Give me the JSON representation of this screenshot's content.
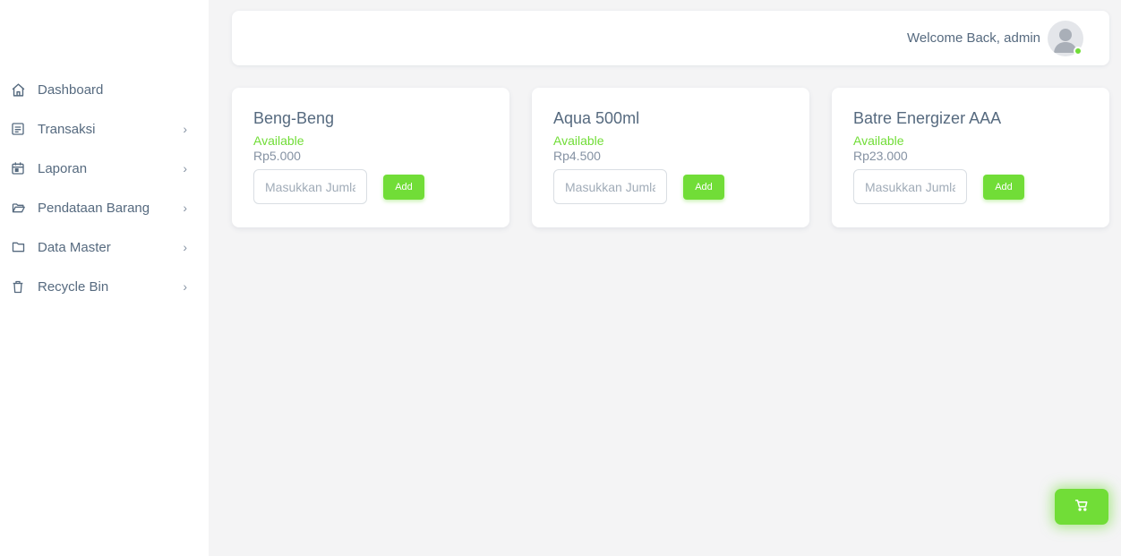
{
  "sidebar": {
    "items": [
      {
        "label": "Dashboard",
        "icon": "home-icon",
        "has_submenu": false
      },
      {
        "label": "Transaksi",
        "icon": "receipt-icon",
        "has_submenu": true
      },
      {
        "label": "Laporan",
        "icon": "calendar-icon",
        "has_submenu": true
      },
      {
        "label": "Pendataan Barang",
        "icon": "folder-open-icon",
        "has_submenu": true
      },
      {
        "label": "Data Master",
        "icon": "folder-icon",
        "has_submenu": true
      },
      {
        "label": "Recycle Bin",
        "icon": "trash-icon",
        "has_submenu": true
      }
    ],
    "chevron": "›"
  },
  "navbar": {
    "welcome": "Welcome Back, admin",
    "avatar_icon": "user-avatar-icon",
    "status": "online"
  },
  "products": [
    {
      "name": "Beng-Beng",
      "status": "Available",
      "price": "Rp5.000",
      "qty_placeholder": "Masukkan Jumlah",
      "add_label": "Add"
    },
    {
      "name": "Aqua 500ml",
      "status": "Available",
      "price": "Rp4.500",
      "qty_placeholder": "Masukkan Jumlah",
      "add_label": "Add"
    },
    {
      "name": "Batre Energizer AAA",
      "status": "Available",
      "price": "Rp23.000",
      "qty_placeholder": "Masukkan Jumlah",
      "add_label": "Add"
    }
  ],
  "cart": {
    "icon": "cart-icon"
  },
  "colors": {
    "accent_green": "#71dd37",
    "text": "#566a7f",
    "background": "#f4f4f5"
  }
}
